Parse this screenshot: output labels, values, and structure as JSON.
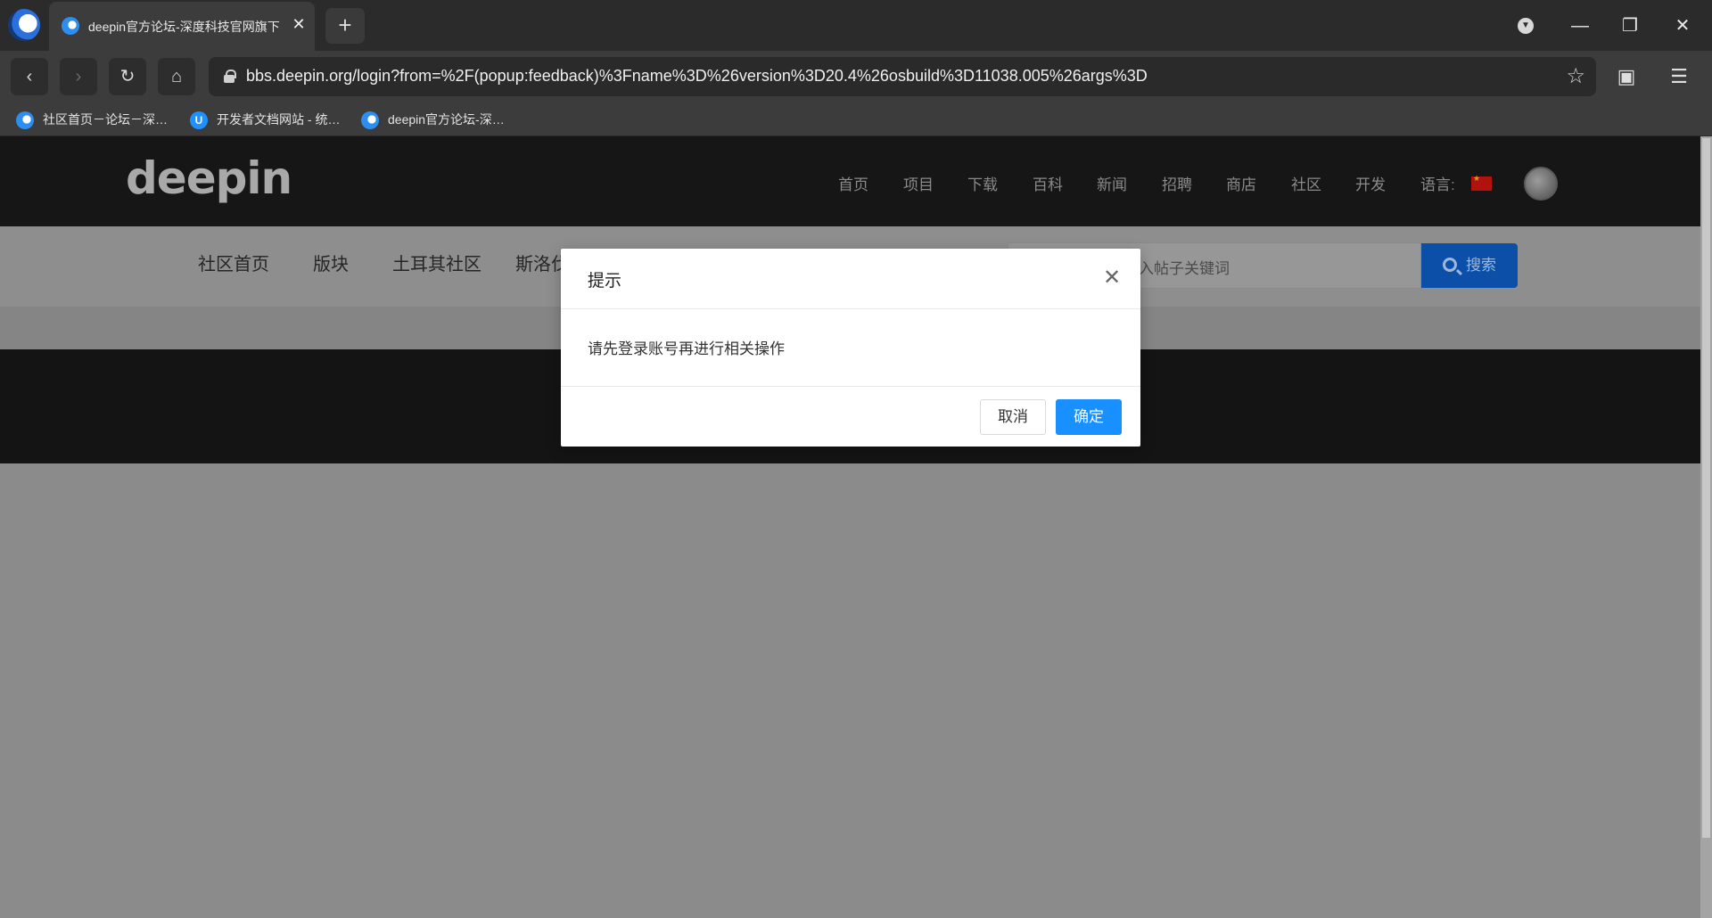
{
  "browser": {
    "tab_title": "deepin官方论坛-深度科技官网旗下",
    "tab_close": "✕",
    "new_tab": "+",
    "url": "bbs.deepin.org/login?from=%2F(popup:feedback)%3Fname%3D%26version%3D20.4%26osbuild%3D11038.005%26args%3D",
    "bookmarks": [
      {
        "label": "社区首页－论坛－深…",
        "icon": "deepin-icon"
      },
      {
        "label": "开发者文档网站 - 统…",
        "icon": "uos-icon"
      },
      {
        "label": "deepin官方论坛-深…",
        "icon": "deepin-icon"
      }
    ]
  },
  "site": {
    "logo": "deepin",
    "nav": [
      "首页",
      "项目",
      "下载",
      "百科",
      "新闻",
      "招聘",
      "商店",
      "社区",
      "开发"
    ],
    "language_label": "语言:",
    "forum_tabs": [
      "社区首页",
      "版块",
      "土耳其社区",
      "斯洛伐"
    ],
    "search_placeholder": "入帖子关键词",
    "search_button": "搜索"
  },
  "modal": {
    "title": "提示",
    "message": "请先登录账号再进行相关操作",
    "cancel": "取消",
    "ok": "确定"
  },
  "colors": {
    "accent": "#1890ff",
    "search_button": "#0c4fa8"
  }
}
